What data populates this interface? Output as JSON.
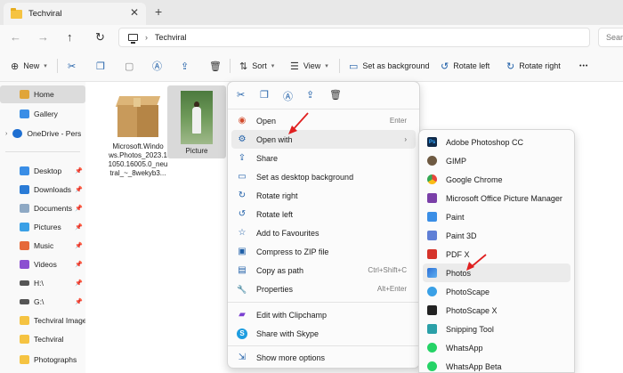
{
  "window": {
    "tab_title": "Techviral",
    "close_glyph": "✕",
    "new_tab_glyph": "+"
  },
  "address_bar": {
    "path": "Techviral",
    "chevron": "›",
    "search_placeholder": "Search",
    "back": "←",
    "forward": "→",
    "up": "↑",
    "refresh": "↻"
  },
  "toolbar": {
    "new_label": "New",
    "sort_label": "Sort",
    "view_label": "View",
    "set_background_label": "Set as background",
    "rotate_left_label": "Rotate left",
    "rotate_right_label": "Rotate right",
    "more_glyph": "•••"
  },
  "sidebar": {
    "items": [
      {
        "label": "Home",
        "icon": "home-icon",
        "color": "#e0a53a"
      },
      {
        "label": "Gallery",
        "icon": "gallery-icon",
        "color": "#3a8ee6"
      },
      {
        "label": "OneDrive - Pers",
        "icon": "onedrive-icon",
        "color": "#1e6fd1"
      },
      {
        "label": "Desktop",
        "icon": "desktop-icon",
        "color": "#3a8ee6"
      },
      {
        "label": "Downloads",
        "icon": "downloads-icon",
        "color": "#2a7bd6"
      },
      {
        "label": "Documents",
        "icon": "documents-icon",
        "color": "#8fa9c4"
      },
      {
        "label": "Pictures",
        "icon": "pictures-icon",
        "color": "#3aa0e6"
      },
      {
        "label": "Music",
        "icon": "music-icon",
        "color": "#e6693a"
      },
      {
        "label": "Videos",
        "icon": "videos-icon",
        "color": "#8b4fd1"
      },
      {
        "label": "H:\\",
        "icon": "drive-icon",
        "color": "#555555"
      },
      {
        "label": "G:\\",
        "icon": "drive-icon",
        "color": "#555555"
      },
      {
        "label": "Techviral Images",
        "icon": "folder-icon",
        "color": "#f5c342"
      },
      {
        "label": "Techviral",
        "icon": "folder-icon",
        "color": "#f5c342"
      },
      {
        "label": "Photographs",
        "icon": "folder-icon",
        "color": "#f5c342"
      }
    ]
  },
  "files": [
    {
      "name_lines": [
        "Microsoft.Windo",
        "ws.Photos_2023.1",
        "1050.16005.0_neu",
        "tral_~_8wekyb3..."
      ],
      "type": "package"
    },
    {
      "name_lines": [
        "Picture"
      ],
      "type": "image"
    }
  ],
  "context_menu": {
    "items": [
      {
        "label": "Open",
        "shortcut": "Enter",
        "icon": "open-icon",
        "glyph": "◉"
      },
      {
        "label": "Open with",
        "shortcut": "",
        "icon": "open-with-icon",
        "glyph": "⚙"
      },
      {
        "label": "Share",
        "shortcut": "",
        "icon": "share-icon",
        "glyph": "⇪"
      },
      {
        "label": "Set as desktop background",
        "shortcut": "",
        "icon": "desktop-bg-icon",
        "glyph": "▭"
      },
      {
        "label": "Rotate right",
        "shortcut": "",
        "icon": "rotate-right-icon",
        "glyph": "↻"
      },
      {
        "label": "Rotate left",
        "shortcut": "",
        "icon": "rotate-left-icon",
        "glyph": "↺"
      },
      {
        "label": "Add to Favourites",
        "shortcut": "",
        "icon": "star-icon",
        "glyph": "☆"
      },
      {
        "label": "Compress to ZIP file",
        "shortcut": "",
        "icon": "zip-icon",
        "glyph": "▣"
      },
      {
        "label": "Copy as path",
        "shortcut": "Ctrl+Shift+C",
        "icon": "copy-path-icon",
        "glyph": "▤"
      },
      {
        "label": "Properties",
        "shortcut": "Alt+Enter",
        "icon": "properties-icon",
        "glyph": "🔧"
      },
      {
        "label": "Edit with Clipchamp",
        "shortcut": "",
        "icon": "clipchamp-icon",
        "glyph": "▰"
      },
      {
        "label": "Share with Skype",
        "shortcut": "",
        "icon": "skype-icon",
        "glyph": "S"
      },
      {
        "label": "Show more options",
        "shortcut": "",
        "icon": "more-options-icon",
        "glyph": "⇲"
      }
    ],
    "submenu_arrow": "›"
  },
  "open_with_submenu": {
    "items": [
      {
        "label": "Adobe Photoshop CC",
        "icon": "photoshop-icon",
        "color": "#0f2a4a",
        "badge": "Ps"
      },
      {
        "label": "GIMP",
        "icon": "gimp-icon",
        "color": "#6e5a42",
        "badge": ""
      },
      {
        "label": "Google Chrome",
        "icon": "chrome-icon",
        "color": "#e8453c",
        "badge": ""
      },
      {
        "label": "Microsoft Office Picture Manager",
        "icon": "picture-manager-icon",
        "color": "#7a3fa8",
        "badge": ""
      },
      {
        "label": "Paint",
        "icon": "paint-icon",
        "color": "#3a8ee6",
        "badge": ""
      },
      {
        "label": "Paint 3D",
        "icon": "paint-3d-icon",
        "color": "#5f7fd6",
        "badge": ""
      },
      {
        "label": "PDF X",
        "icon": "pdf-x-icon",
        "color": "#d6332a",
        "badge": ""
      },
      {
        "label": "Photos",
        "icon": "photos-icon",
        "color": "#2c6fd6",
        "badge": ""
      },
      {
        "label": "PhotoScape",
        "icon": "photoscape-icon",
        "color": "#3aa0e6",
        "badge": ""
      },
      {
        "label": "PhotoScape X",
        "icon": "photoscape-x-icon",
        "color": "#222222",
        "badge": ""
      },
      {
        "label": "Snipping Tool",
        "icon": "snipping-tool-icon",
        "color": "#2ba0a8",
        "badge": ""
      },
      {
        "label": "WhatsApp",
        "icon": "whatsapp-icon",
        "color": "#25d366",
        "badge": ""
      },
      {
        "label": "WhatsApp Beta",
        "icon": "whatsapp-beta-icon",
        "color": "#25d366",
        "badge": ""
      }
    ]
  },
  "colors": {
    "accent": "#1f5fa8",
    "annotation_red": "#e02020",
    "hover": "#ebebeb"
  }
}
